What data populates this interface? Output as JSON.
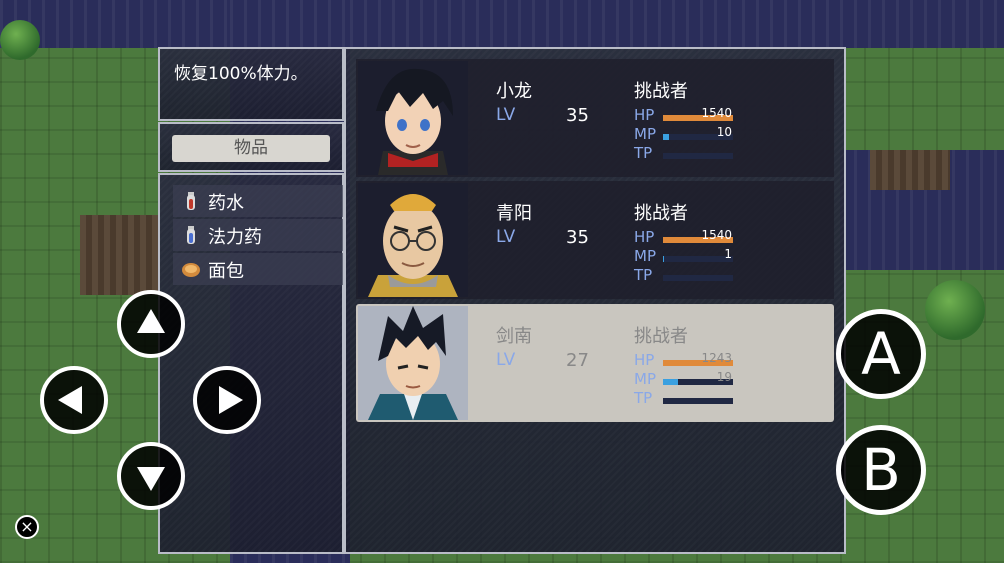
{
  "help": {
    "text": "恢复100%体力。"
  },
  "category": {
    "label": "物品"
  },
  "items": [
    {
      "label": "药水",
      "icon": "red-potion-icon"
    },
    {
      "label": "法力药",
      "icon": "blue-potion-icon"
    },
    {
      "label": "面包",
      "icon": "bread-icon"
    }
  ],
  "party": [
    {
      "name": "小龙",
      "lv_label": "LV",
      "level": "35",
      "class": "挑战者",
      "hp_label": "HP",
      "hp": "1540",
      "hp_ratio": 1.0,
      "mp_label": "MP",
      "mp": "10",
      "mp_ratio": 0.08,
      "tp_label": "TP",
      "tp_ratio": 0
    },
    {
      "name": "青阳",
      "lv_label": "LV",
      "level": "35",
      "class": "挑战者",
      "hp_label": "HP",
      "hp": "1540",
      "hp_ratio": 1.0,
      "mp_label": "MP",
      "mp": "1",
      "mp_ratio": 0.01,
      "tp_label": "TP",
      "tp_ratio": 0
    },
    {
      "name": "剑南",
      "lv_label": "LV",
      "level": "27",
      "class": "挑战者",
      "hp_label": "HP",
      "hp": "1243",
      "hp_ratio": 1.0,
      "mp_label": "MP",
      "mp": "19",
      "mp_ratio": 0.22,
      "tp_label": "TP",
      "tp_ratio": 0
    }
  ],
  "controls": {
    "a_label": "A",
    "b_label": "B",
    "close_label": "×"
  },
  "colors": {
    "hp": "#e08a3a",
    "mp": "#3aa0e0",
    "accent_label": "#8aa8e8"
  }
}
